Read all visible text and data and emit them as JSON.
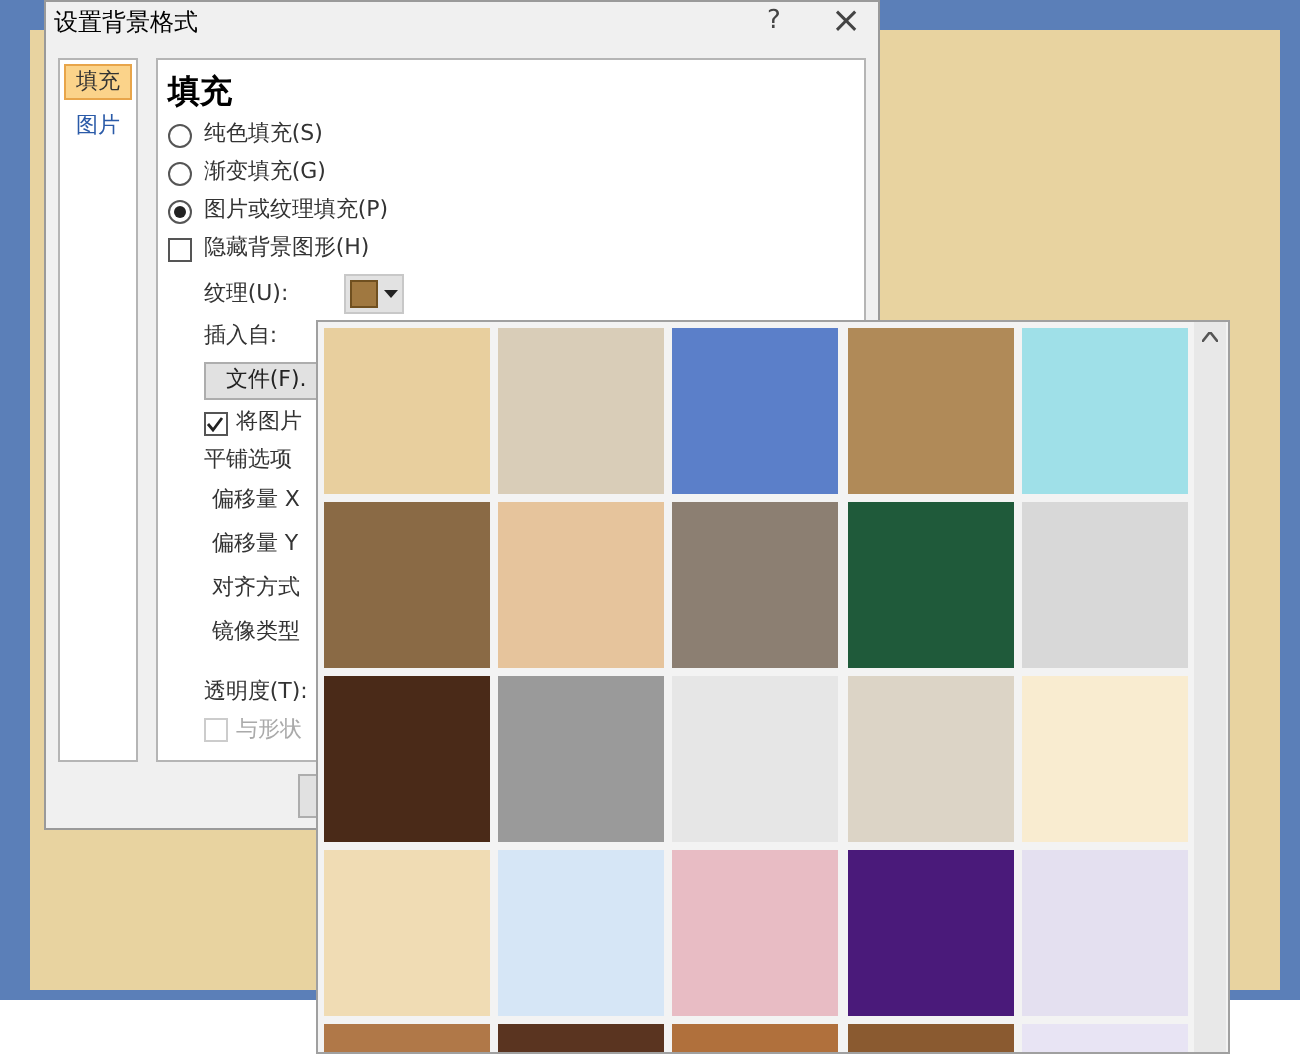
{
  "dialog": {
    "title": "设置背景格式",
    "help": "?",
    "close": "×"
  },
  "nav": [
    {
      "label": "填充",
      "selected": true
    },
    {
      "label": "图片",
      "selected": false
    }
  ],
  "section_title": "填充",
  "fill_options": [
    {
      "kind": "radio",
      "label": "纯色填充(S)",
      "checked": false
    },
    {
      "kind": "radio",
      "label": "渐变填充(G)",
      "checked": false
    },
    {
      "kind": "radio",
      "label": "图片或纹理填充(P)",
      "checked": true
    },
    {
      "kind": "checkbox",
      "label": "隐藏背景图形(H)",
      "checked": false
    }
  ],
  "texture_label": "纹理(U):",
  "insert_from_label": "插入自:",
  "file_button": "文件(F).",
  "tile_checkbox": {
    "label": "将图片",
    "checked": true
  },
  "tiling_options_label": "平铺选项",
  "tiling_fields": [
    "偏移量 X",
    "偏移量 Y",
    "对齐方式",
    "镜像类型"
  ],
  "transparency_label": "透明度(T):",
  "rotate_checkbox": {
    "label": "与形状",
    "checked": false,
    "disabled": true
  },
  "textures": [
    {
      "color": "#e8cf9e"
    },
    {
      "color": "#d9cdb8"
    },
    {
      "color": "#5b7fc9"
    },
    {
      "color": "#b08a58"
    },
    {
      "color": "#9fe0e8"
    },
    {
      "color": "#8a6a45"
    },
    {
      "color": "#e6c49c"
    },
    {
      "color": "#8c7f72"
    },
    {
      "color": "#1f5a3a"
    },
    {
      "color": "#d8d8d8"
    },
    {
      "color": "#4a2a18"
    },
    {
      "color": "#9a9a9a"
    },
    {
      "color": "#e6e6e6"
    },
    {
      "color": "#dcd4c6"
    },
    {
      "color": "#f9ecd0"
    },
    {
      "color": "#f0dcb4"
    },
    {
      "color": "#d6e6f6"
    },
    {
      "color": "#e8bcc4"
    },
    {
      "color": "#4a1a7a"
    },
    {
      "color": "#e4e0f0"
    },
    {
      "color": "#b07848"
    },
    {
      "color": "#5a3420"
    },
    {
      "color": "#b0703c"
    },
    {
      "color": "#8a5a30"
    },
    {
      "color": "#e8e4f4"
    }
  ]
}
